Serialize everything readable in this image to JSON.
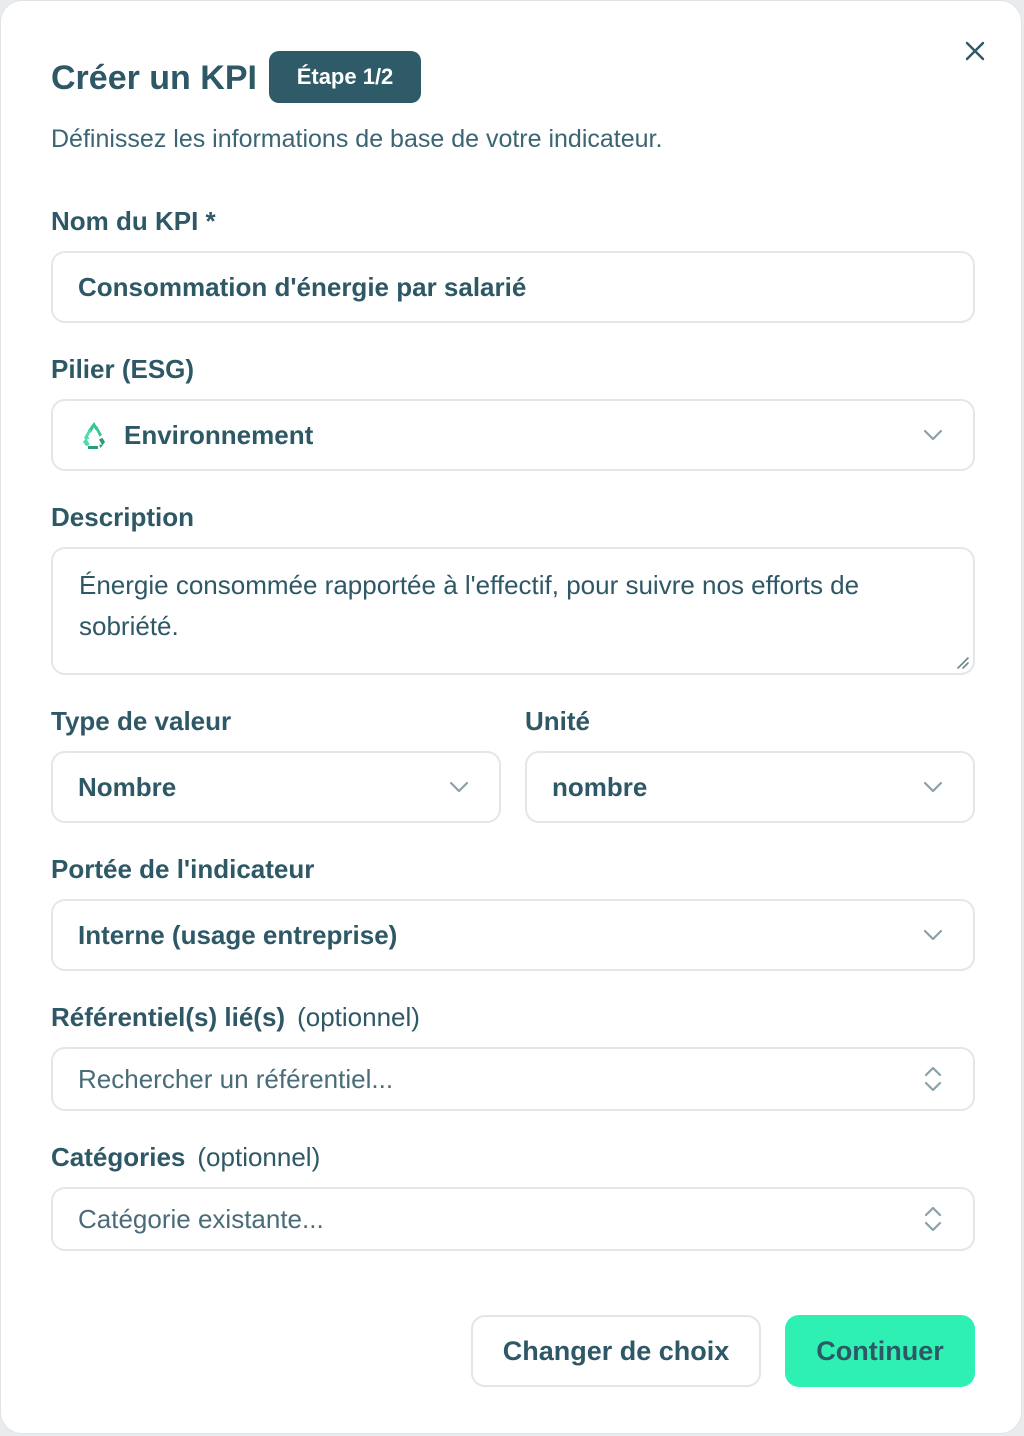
{
  "dialog": {
    "title": "Créer un KPI",
    "step_badge": "Étape 1/2",
    "subtitle": "Définissez les informations de base de votre indicateur.",
    "close_icon": "close-icon"
  },
  "form": {
    "name": {
      "label": "Nom du KPI *",
      "value": "Consommation d'énergie par salarié"
    },
    "pillar": {
      "label": "Pilier (ESG)",
      "value": "Environnement",
      "icon": "recycle-icon"
    },
    "description": {
      "label": "Description",
      "value": "Énergie consommée rapportée à l'effectif, pour suivre nos efforts de sobriété."
    },
    "value_type": {
      "label": "Type de valeur",
      "value": "Nombre"
    },
    "unit": {
      "label": "Unité",
      "value": "nombre"
    },
    "scope": {
      "label": "Portée de l'indicateur",
      "value": "Interne (usage entreprise)"
    },
    "frameworks": {
      "label": "Référentiel(s) lié(s)",
      "optional": "(optionnel)",
      "placeholder": "Rechercher un référentiel..."
    },
    "categories": {
      "label": "Catégories",
      "optional": "(optionnel)",
      "placeholder": "Catégorie existante..."
    }
  },
  "actions": {
    "secondary_label": "Changer de choix",
    "primary_label": "Continuer"
  },
  "colors": {
    "primary": "#2ef0b3",
    "text": "#2e5866",
    "badge": "#2f5a68"
  }
}
